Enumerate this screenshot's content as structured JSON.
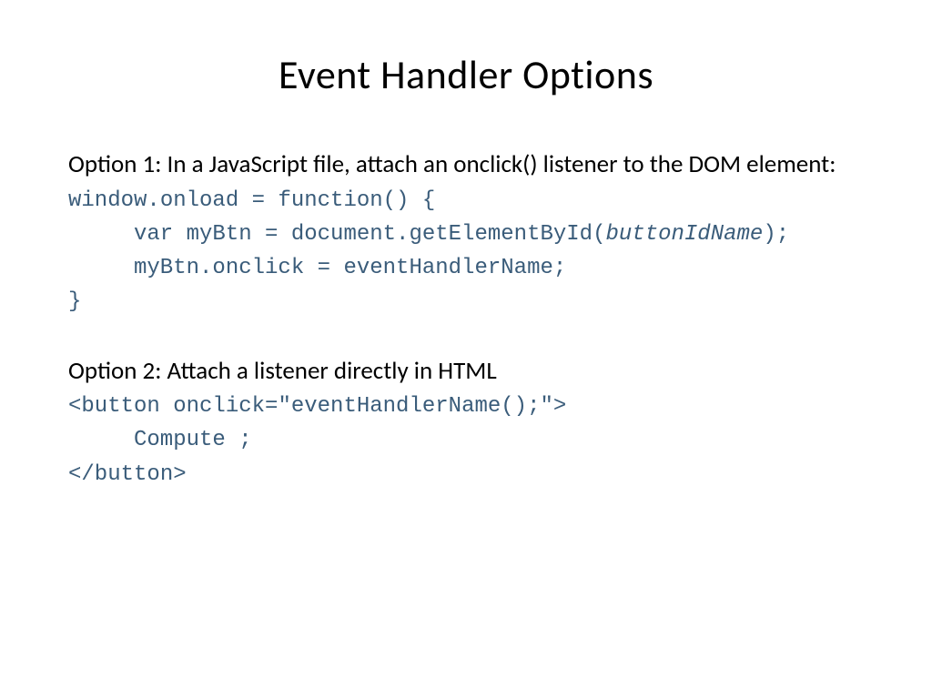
{
  "title": "Event Handler Options",
  "option1": {
    "heading": "Option 1: In a JavaScript file, attach an onclick() listener to the DOM element:",
    "code": {
      "line1": "window.onload = function() {",
      "line2_a": "var myBtn = document.getElementById(",
      "line2_em": "buttonIdName",
      "line2_b": ");",
      "line3": "myBtn.onclick = eventHandlerName;",
      "line4": "}"
    }
  },
  "option2": {
    "heading": "Option 2: Attach a listener directly in HTML",
    "code": {
      "line1": "<button onclick=\"eventHandlerName();\">",
      "line2": "Compute ;",
      "line3": "</button>"
    }
  }
}
